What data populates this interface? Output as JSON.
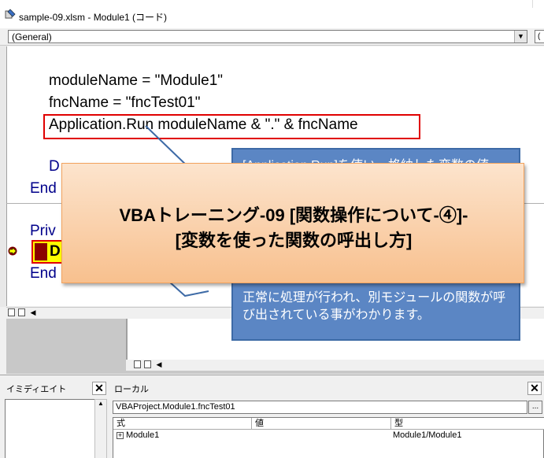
{
  "window": {
    "title": "sample-09.xlsm - Module1 (コード)"
  },
  "combos": {
    "object": "(General)",
    "proc": "("
  },
  "code": {
    "line1": "moduleName = \"Module1\"",
    "line2": "fncName = \"fncTest01\"",
    "line3": "Application.Run moduleName & \".\" & fncName",
    "line4_partial": "D",
    "end1": "End",
    "priv": "Priv",
    "current_letter": "D",
    "end2": "End"
  },
  "callout": {
    "top_text": "[Application.Run]を使い、格納した変数の値",
    "body_text": "正常に処理が行われ、別モジュールの関数が呼び出されている事がわかります。"
  },
  "banner": {
    "line1": "VBAトレーニング-09 [関数操作について-④]-",
    "line2": "[変数を使った関数の呼出し方]"
  },
  "immediate": {
    "title": "イミディエイト"
  },
  "locals": {
    "title": "ローカル",
    "context": "VBAProject.Module1.fncTest01",
    "context_button": "...",
    "columns": [
      "式",
      "値",
      "型"
    ],
    "rows": [
      {
        "expr": "Module1",
        "value": "",
        "type": "Module1/Module1"
      }
    ]
  },
  "colors": {
    "highlight": "#ffff00",
    "red_box": "#e00000",
    "callout_bg": "#5b86c4",
    "banner_bg": "#f8c08e"
  }
}
